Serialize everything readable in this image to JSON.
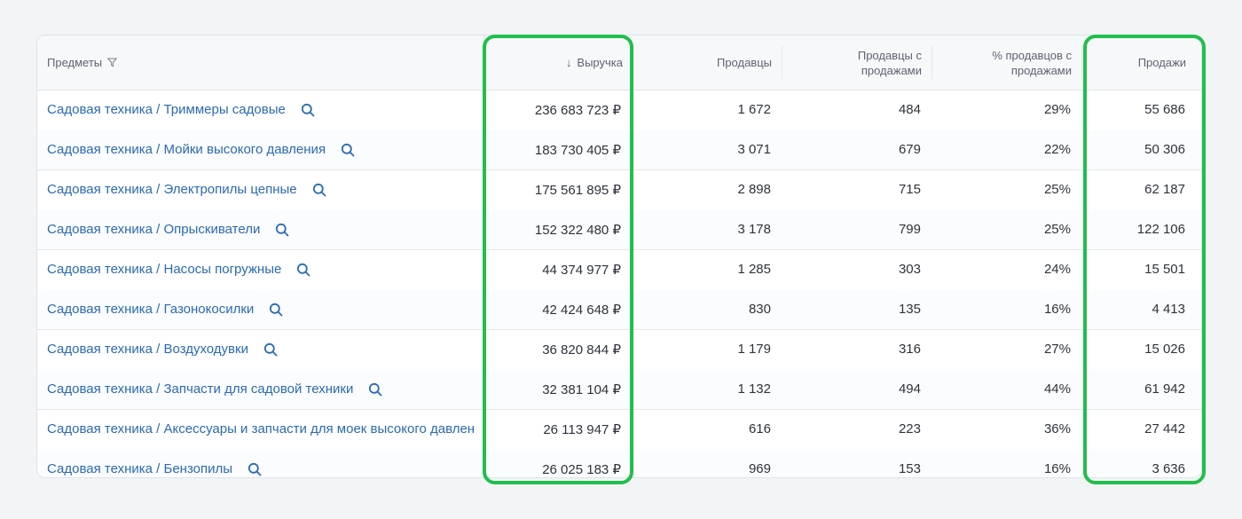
{
  "columns": {
    "subjects": "Предметы",
    "revenue": "Выручка",
    "revenue_sort_arrow": "↓",
    "sellers": "Продавцы",
    "sellers_with_sales_line1": "Продавцы с",
    "sellers_with_sales_line2": "продажами",
    "pct_sellers_line1": "% продавцов с",
    "pct_sellers_line2": "продажами",
    "sales": "Продажи"
  },
  "rows": [
    {
      "name": "Садовая техника / Триммеры садовые",
      "revenue": "236 683 723 ₽",
      "sellers": "1 672",
      "sellers_with_sales": "484",
      "pct": "29%",
      "sales": "55 686"
    },
    {
      "name": "Садовая техника / Мойки высокого давления",
      "revenue": "183 730 405 ₽",
      "sellers": "3 071",
      "sellers_with_sales": "679",
      "pct": "22%",
      "sales": "50 306"
    },
    {
      "name": "Садовая техника / Электропилы цепные",
      "revenue": "175 561 895 ₽",
      "sellers": "2 898",
      "sellers_with_sales": "715",
      "pct": "25%",
      "sales": "62 187"
    },
    {
      "name": "Садовая техника / Опрыскиватели",
      "revenue": "152 322 480 ₽",
      "sellers": "3 178",
      "sellers_with_sales": "799",
      "pct": "25%",
      "sales": "122 106"
    },
    {
      "name": "Садовая техника / Насосы погружные",
      "revenue": "44 374 977 ₽",
      "sellers": "1 285",
      "sellers_with_sales": "303",
      "pct": "24%",
      "sales": "15 501"
    },
    {
      "name": "Садовая техника / Газонокосилки",
      "revenue": "42 424 648 ₽",
      "sellers": "830",
      "sellers_with_sales": "135",
      "pct": "16%",
      "sales": "4 413"
    },
    {
      "name": "Садовая техника / Воздуходувки",
      "revenue": "36 820 844 ₽",
      "sellers": "1 179",
      "sellers_with_sales": "316",
      "pct": "27%",
      "sales": "15 026"
    },
    {
      "name": "Садовая техника / Запчасти для садовой техники",
      "revenue": "32 381 104 ₽",
      "sellers": "1 132",
      "sellers_with_sales": "494",
      "pct": "44%",
      "sales": "61 942"
    },
    {
      "name": "Садовая техника / Аксессуары и запчасти для моек высокого давлен",
      "revenue": "26 113 947 ₽",
      "sellers": "616",
      "sellers_with_sales": "223",
      "pct": "36%",
      "sales": "27 442"
    },
    {
      "name": "Садовая техника / Бензопилы",
      "revenue": "26 025 183 ₽",
      "sellers": "969",
      "sellers_with_sales": "153",
      "pct": "16%",
      "sales": "3 636"
    }
  ],
  "icons": {
    "filter": "filter-icon",
    "search": "search-icon"
  },
  "colors": {
    "link": "#2a6ab1",
    "highlight": "#1fbf4b"
  }
}
